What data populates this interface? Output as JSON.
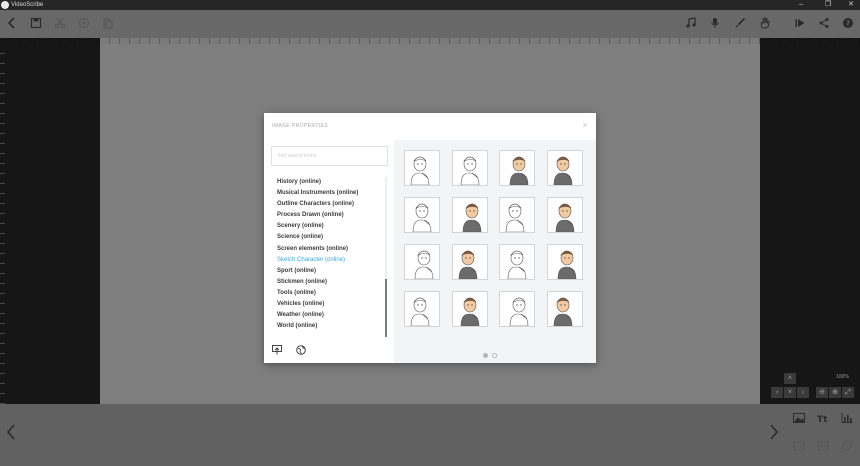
{
  "window": {
    "title": "VideoScribe",
    "controls": [
      "–",
      "❐",
      "✕"
    ]
  },
  "toolbar": {
    "left_icons": [
      "back-icon",
      "save-icon",
      "cut-icon",
      "copy-icon",
      "paste-icon"
    ],
    "right_icons": [
      "music-icon",
      "microphone-icon",
      "brush-icon",
      "hand-icon",
      "play-icon",
      "share-icon",
      "help-icon"
    ]
  },
  "zoom": {
    "level": "100%"
  },
  "dialog": {
    "title": "IMAGE PROPERTIES",
    "search_placeholder": "find search terms",
    "categories": [
      {
        "label": "History (online)",
        "active": false
      },
      {
        "label": "Musical Instruments (online)",
        "active": false
      },
      {
        "label": "Outline Characters (online)",
        "active": false
      },
      {
        "label": "Process Drawn (online)",
        "active": false
      },
      {
        "label": "Scenery (online)",
        "active": false
      },
      {
        "label": "Science (online)",
        "active": false
      },
      {
        "label": "Screen elements (online)",
        "active": false
      },
      {
        "label": "Sketch Character (online)",
        "active": true
      },
      {
        "label": "Sport (online)",
        "active": false
      },
      {
        "label": "Stickmen (online)",
        "active": false
      },
      {
        "label": "Tools (online)",
        "active": false
      },
      {
        "label": "Vehicles (online)",
        "active": false
      },
      {
        "label": "Weather (online)",
        "active": false
      },
      {
        "label": "World (online)",
        "active": false
      }
    ],
    "footer_icons": [
      "import-icon",
      "globe-icon"
    ],
    "thumbnails": [
      {
        "style": "outline"
      },
      {
        "style": "outline"
      },
      {
        "style": "color"
      },
      {
        "style": "color"
      },
      {
        "style": "outline"
      },
      {
        "style": "color"
      },
      {
        "style": "outline"
      },
      {
        "style": "color"
      },
      {
        "style": "outline"
      },
      {
        "style": "color"
      },
      {
        "style": "outline"
      },
      {
        "style": "color"
      },
      {
        "style": "outline"
      },
      {
        "style": "color"
      },
      {
        "style": "outline"
      },
      {
        "style": "color"
      }
    ],
    "pages": {
      "count": 2,
      "current": 1
    }
  },
  "colors": {
    "accent": "#3aa8d8",
    "hair": "#8a5a32",
    "skin": "#f2c9a0",
    "suit": "#6b6b6b"
  }
}
